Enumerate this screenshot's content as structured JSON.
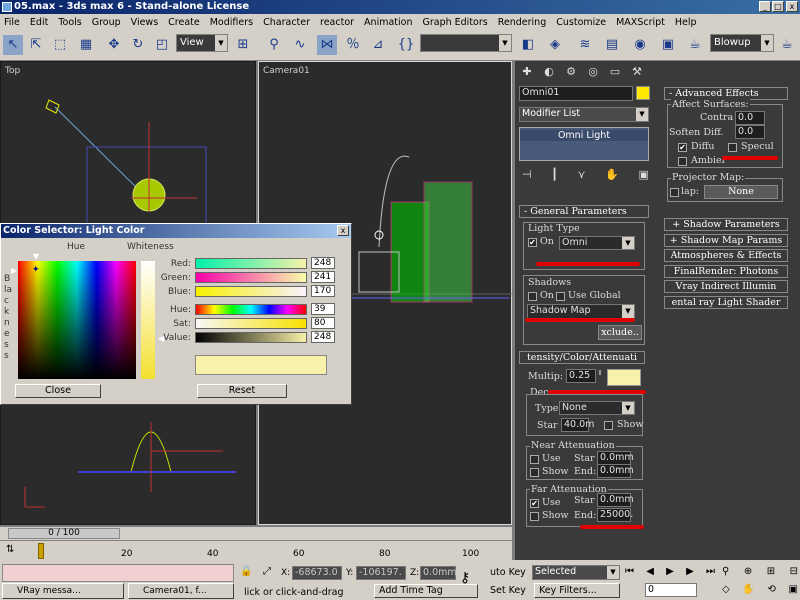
{
  "window": {
    "title": "05.max - 3ds max 6 - Stand-alone License",
    "min": "_",
    "max": "□",
    "close": "x"
  },
  "menu": [
    "File",
    "Edit",
    "Tools",
    "Group",
    "Views",
    "Create",
    "Modifiers",
    "Character",
    "reactor",
    "Animation",
    "Graph Editors",
    "Rendering",
    "Customize",
    "MAXScript",
    "Help"
  ],
  "toolbar": {
    "view_dropdown": "View",
    "render_dropdown": "Blowup"
  },
  "viewports": {
    "top_label": "Top",
    "camera_label": "Camera01"
  },
  "command_panel": {
    "object_name": "Omni01",
    "modifier_list": "Modifier List",
    "stack_item": "Omni Light",
    "general": {
      "header": "- General Parameters",
      "light_type": "Light Type",
      "on": "On",
      "type_value": "Omni",
      "shadows": "Shadows",
      "use_global": "Use Global",
      "shadow_type": "Shadow Map",
      "exclude": "xclude.."
    },
    "intensity": {
      "header": "tensity/Color/Attenuati",
      "multiplier_label": "Multip:",
      "multiplier_value": "0.25",
      "decay_label": "Deca",
      "type_label": "Type",
      "type_value": "None",
      "start_label": "Star",
      "start_value": "40.0m",
      "show": "Show",
      "near_attenuation": "Near Attenuation",
      "use": "Use",
      "start": "Star",
      "end": "End:",
      "near_start": "0.0mm",
      "near_end": "0.0mm",
      "far_attenuation": "Far Attenuation",
      "far_start": "0.0mm",
      "far_end": "25000."
    },
    "advanced": {
      "header": "- Advanced Effects",
      "affect_surfaces": "Affect Surfaces:",
      "contrast_label": "Contra",
      "contrast_value": "0.0",
      "soften_label": "Soften Diff.",
      "soften_value": "0.0",
      "diffuse": "Diffu",
      "specular": "Specul",
      "ambient": "Ambier",
      "projector_map": "Projector Map:",
      "map": "lap:",
      "none": "None"
    },
    "rollouts": [
      "+ Shadow Parameters",
      "+ Shadow Map Params",
      "Atmospheres & Effects",
      "FinalRender: Photons",
      "Vray Indirect Illumin",
      "ental ray Light Shader"
    ]
  },
  "color_dialog": {
    "title": "Color Selector: Light Color",
    "hue": "Hue",
    "whiteness": "Whiteness",
    "blackness": "Blackness",
    "red_label": "Red:",
    "green_label": "Green:",
    "blue_label": "Blue:",
    "hue_label": "Hue:",
    "sat_label": "Sat:",
    "value_label": "Value:",
    "red": "248",
    "green": "241",
    "blue": "170",
    "hue_value": "39",
    "sat": "80",
    "value": "248",
    "close": "Close",
    "reset": "Reset"
  },
  "timeline": {
    "frame": "0 / 100",
    "ticks": [
      "20",
      "40",
      "60",
      "80",
      "100"
    ]
  },
  "status": {
    "x_label": "X:",
    "x_value": "-68673.0",
    "y_label": "Y:",
    "y_value": "-106197.",
    "z_label": "Z:",
    "z_value": "0.0mm",
    "auto_key": "uto Key",
    "selected": "Selected",
    "set_key": "Set Key",
    "key_filters": "Key Filters...",
    "frame_value": "0",
    "prompt": "lick or click-and-drag",
    "add_time_tag": "Add Time Tag",
    "task1": "VRay messa...",
    "task2": "Camera01, f..."
  },
  "colors": {
    "light_color": "#f8f1aa",
    "swatch": "#ffe800",
    "accent": "#e00000"
  }
}
